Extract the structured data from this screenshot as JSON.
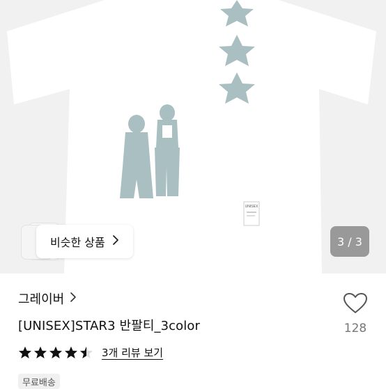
{
  "hero": {
    "similar_products_label": "비슷한 상품",
    "image_counter": "3 / 3",
    "shirt_tag_text": "UNISEX"
  },
  "product": {
    "brand": "그레이버",
    "name": "[UNISEX]STAR3 반팔티_3color",
    "rating": 4.5,
    "rating_max": 5,
    "review_link": "3개 리뷰 보기",
    "like_count": "128",
    "shipping_badge": "무료배송"
  },
  "colors": {
    "print_color": "#a9bfc1",
    "star_fill": "#111111",
    "hero_background": "#f1f1f1"
  },
  "icons": {
    "brand_chevron": "chevron-right-icon",
    "similar_chevron": "chevron-right-icon",
    "like": "heart-outline-icon",
    "rating": "star-icon"
  }
}
